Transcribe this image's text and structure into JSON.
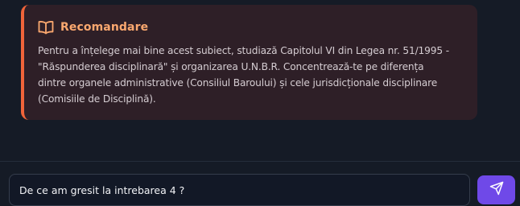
{
  "recommendation": {
    "title": "Recomandare",
    "icon": "open-book-icon",
    "body": "Pentru a înțelege mai bine acest subiect, studiază Capitolul VI din Legea nr. 51/1995 -\n\"Răspunderea disciplinară\" și organizarea U.N.B.R. Concentrează-te pe diferența\ndintre organele administrative (Consiliul Baroului) și cele jurisdicționale disciplinare\n(Comisiile de Disciplină).",
    "accent_color": "#f0643a",
    "title_color": "#fba86f"
  },
  "composer": {
    "input_value": "De ce am gresit la intrebarea 4 ?",
    "send_icon": "paper-plane-icon",
    "send_color": "#6f49e8"
  }
}
